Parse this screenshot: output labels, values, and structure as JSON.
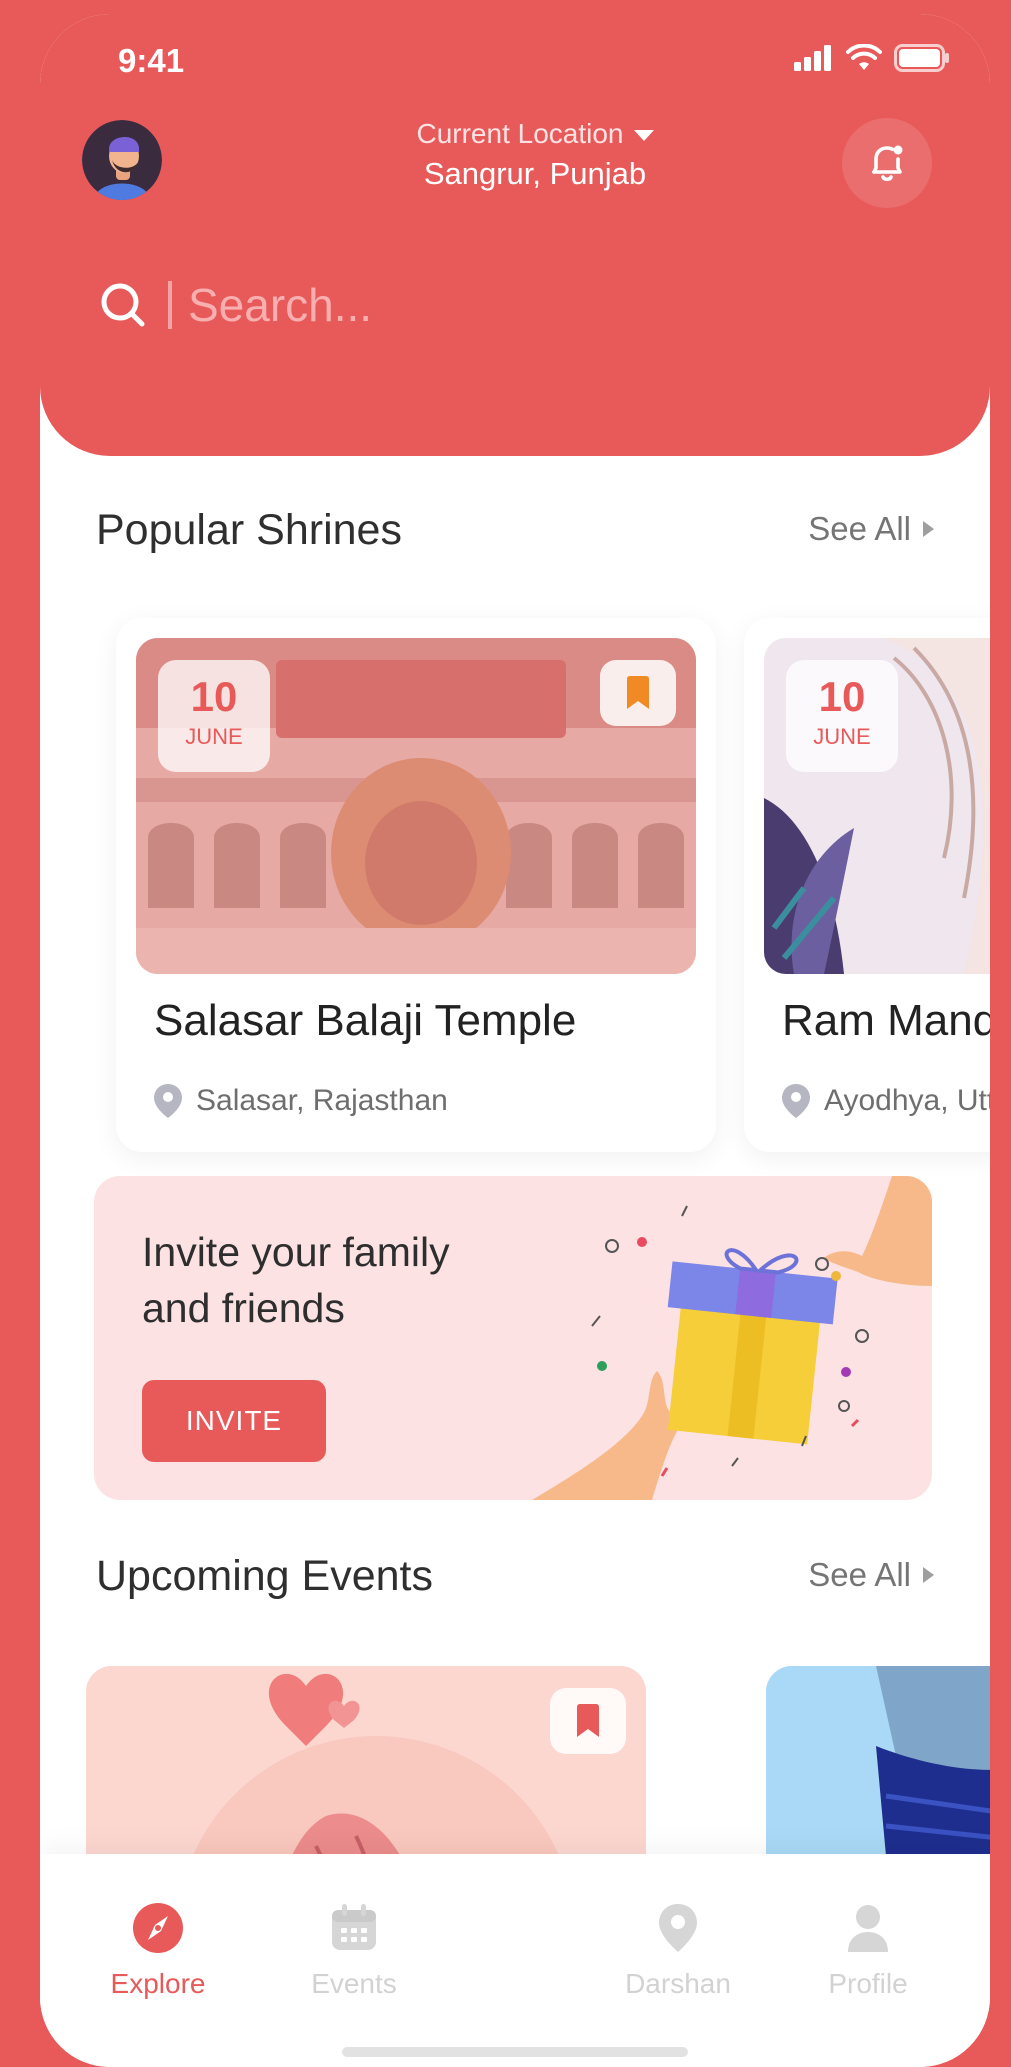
{
  "status_bar": {
    "time": "9:41"
  },
  "header": {
    "location_label": "Current Location",
    "location_value": "Sangrur, Punjab",
    "search_placeholder": "Search..."
  },
  "popular": {
    "title": "Popular Shrines",
    "see_all": "See All",
    "cards": [
      {
        "title": "Salasar Balaji Temple",
        "location": "Salasar, Rajasthan",
        "day": "10",
        "month": "JUNE"
      },
      {
        "title": "Ram Mandir",
        "location": "Ayodhya, Uttar Pradesh",
        "day": "10",
        "month": "JUNE"
      }
    ]
  },
  "invite": {
    "line1": "Invite your family",
    "line2": "and friends",
    "button": "INVITE"
  },
  "events": {
    "title": "Upcoming Events",
    "see_all": "See All"
  },
  "tabs": [
    {
      "label": "Explore",
      "icon": "compass-icon",
      "active": true
    },
    {
      "label": "Events",
      "icon": "calendar-icon",
      "active": false
    },
    {
      "label": "Darshan",
      "icon": "location-pin-icon",
      "active": false
    },
    {
      "label": "Profile",
      "icon": "user-icon",
      "active": false
    }
  ],
  "colors": {
    "accent": "#E85A5A",
    "invite_bg": "#FCE2E3",
    "bookmark_orange": "#F08A24"
  }
}
